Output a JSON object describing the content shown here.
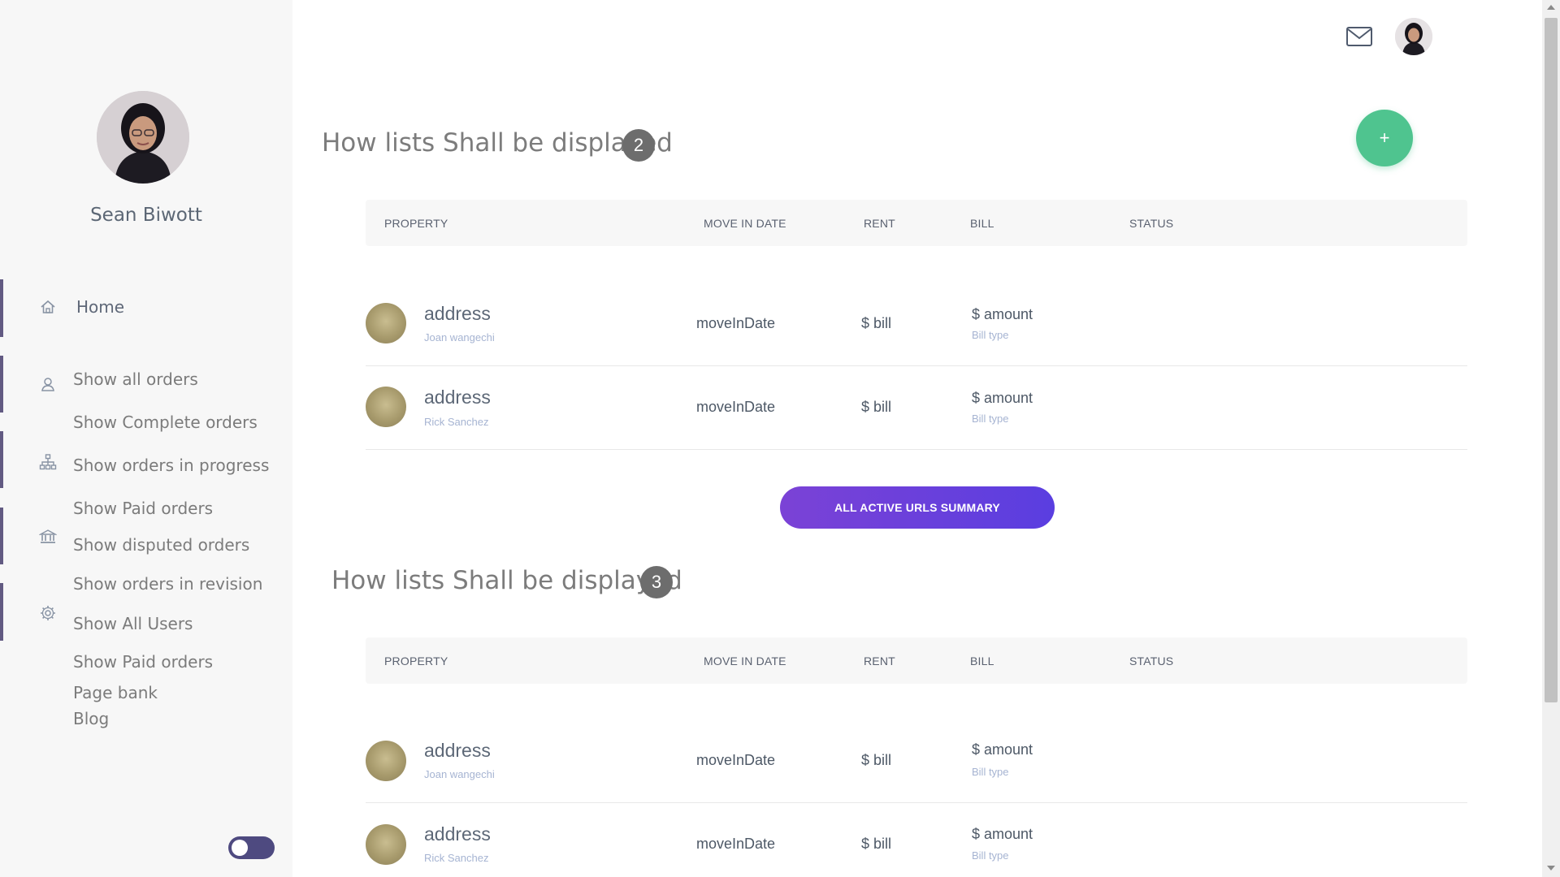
{
  "sidebar": {
    "profile_name": "Sean Biwott",
    "nav": [
      {
        "label": "Home",
        "icon": "home-icon"
      },
      {
        "label": "Show all orders",
        "icon": "user-icon"
      },
      {
        "label": "Show Complete orders"
      },
      {
        "label": "Show orders in progress",
        "icon": "sitemap-icon"
      },
      {
        "label": "Show Paid orders"
      },
      {
        "label": "Show disputed orders",
        "icon": "bank-icon"
      },
      {
        "label": "Show orders in revision"
      },
      {
        "label": "Show All Users",
        "icon": "gear-icon"
      },
      {
        "label": "Show Paid orders"
      },
      {
        "label": "Page bank"
      },
      {
        "label": "Blog"
      }
    ],
    "accent_color": "#625a82"
  },
  "header": {
    "icons": [
      "mail-icon",
      "avatar"
    ]
  },
  "fab": {
    "label": "+",
    "color": "#4fc48f"
  },
  "sections": [
    {
      "title": "How lists Shall be displayed",
      "count": "2",
      "columns": [
        "PROPERTY",
        "MOVE IN DATE",
        "RENT",
        "BILL",
        "STATUS"
      ],
      "rows": [
        {
          "address": "address",
          "tenant": "Joan wangechi",
          "move_in": "moveInDate",
          "rent": "$ bill",
          "amount": "$ amount",
          "bill_type": "Bill type"
        },
        {
          "address": "address",
          "tenant": "Rick Sanchez",
          "move_in": "moveInDate",
          "rent": "$ bill",
          "amount": "$ amount",
          "bill_type": "Bill type"
        }
      ]
    },
    {
      "title": "How lists Shall be displayed",
      "count": "3",
      "columns": [
        "PROPERTY",
        "MOVE IN DATE",
        "RENT",
        "BILL",
        "STATUS"
      ],
      "rows": [
        {
          "address": "address",
          "tenant": "Joan wangechi",
          "move_in": "moveInDate",
          "rent": "$ bill",
          "amount": "$ amount",
          "bill_type": "Bill type"
        },
        {
          "address": "address",
          "tenant": "Rick Sanchez",
          "move_in": "moveInDate",
          "rent": "$ bill",
          "amount": "$ amount",
          "bill_type": "Bill type"
        }
      ]
    }
  ],
  "summary_button": {
    "label": "ALL ACTIVE URLS SUMMARY",
    "color": "#6a40dc"
  },
  "theme_toggle": {
    "color": "#4e4a80"
  }
}
